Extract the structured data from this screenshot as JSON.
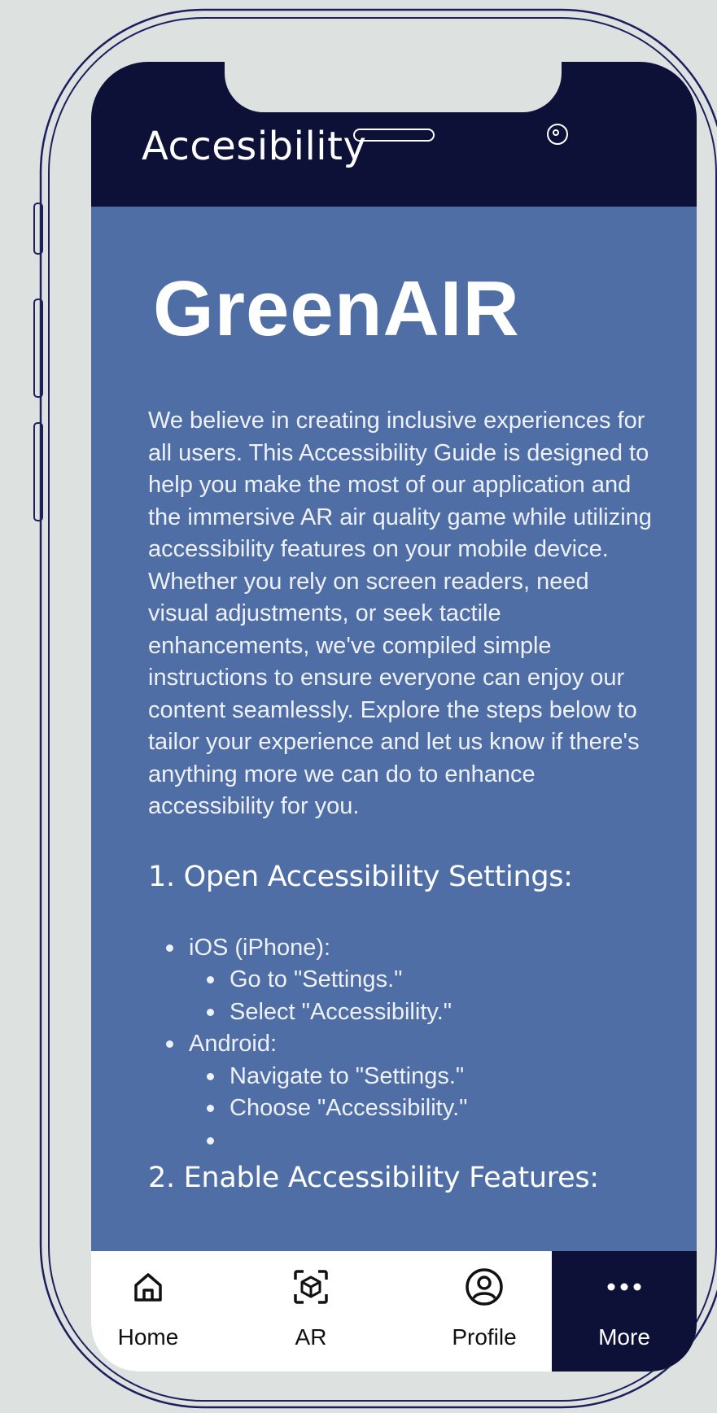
{
  "header": {
    "title": "Accesibility"
  },
  "content": {
    "brand": "GreenAIR",
    "intro": "We believe in creating inclusive experiences for all users. This Accessibility Guide is designed to help you make the most of our application and the immersive AR air quality game while utilizing accessibility features on your mobile device. Whether you rely on screen readers, need visual adjustments, or seek tactile enhancements, we've compiled simple instructions to ensure everyone can enjoy our content seamlessly. Explore the steps below to tailor your experience and let us know if there's anything more we can do to enhance accessibility for you.",
    "section1": {
      "heading": "1. Open Accessibility Settings:",
      "items": [
        {
          "label": "iOS (iPhone):",
          "sub": [
            "Go to \"Settings.\"",
            "Select \"Accessibility.\""
          ]
        },
        {
          "label": "Android:",
          "sub": [
            "Navigate to \"Settings.\"",
            "Choose \"Accessibility.\"",
            ""
          ]
        }
      ]
    },
    "section2": {
      "heading": "2. Enable Accessibility Features:"
    }
  },
  "tabbar": {
    "tabs": [
      {
        "label": "Home",
        "icon": "home-icon"
      },
      {
        "label": "AR",
        "icon": "ar-cube-icon"
      },
      {
        "label": "Profile",
        "icon": "profile-icon"
      },
      {
        "label": "More",
        "icon": "more-dots-icon",
        "active": true
      }
    ]
  },
  "colors": {
    "header_bg": "#0d1037",
    "content_bg": "#4f6ea6",
    "page_bg": "#dde1e0",
    "tab_active_bg": "#0d1037",
    "tab_bg": "#ffffff",
    "phone_outline": "#1c1f5c"
  }
}
